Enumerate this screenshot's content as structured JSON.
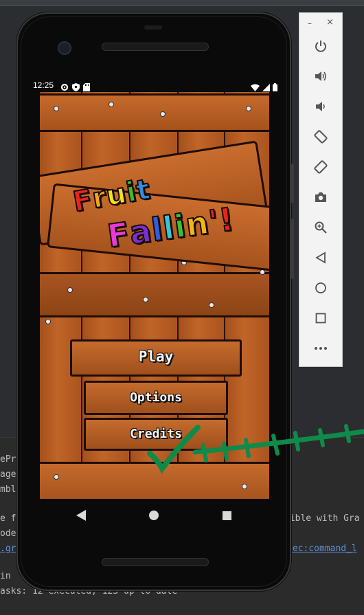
{
  "status_bar": {
    "time": "12:25",
    "left_icons": [
      "gear-icon",
      "shield-icon",
      "sd-card-icon"
    ],
    "right_icons": [
      "wifi-icon",
      "signal-icon",
      "battery-icon"
    ]
  },
  "game": {
    "title_line1": "Fruit",
    "title_line2": "Fallin'!",
    "title_line1_letters": [
      {
        "ch": "F",
        "color": "#e8241f"
      },
      {
        "ch": "r",
        "color": "#f2a51a"
      },
      {
        "ch": "u",
        "color": "#f2e11a"
      },
      {
        "ch": "i",
        "color": "#38c02f"
      },
      {
        "ch": "t",
        "color": "#2f8ee0"
      }
    ],
    "title_line2_letters": [
      {
        "ch": "F",
        "color": "#e63bd8"
      },
      {
        "ch": "a",
        "color": "#7a2fd6"
      },
      {
        "ch": "l",
        "color": "#2f5fe0"
      },
      {
        "ch": "l",
        "color": "#34c7d9"
      },
      {
        "ch": "i",
        "color": "#36c437"
      },
      {
        "ch": "n",
        "color": "#f2b51a"
      },
      {
        "ch": "'",
        "color": "#e8241f"
      },
      {
        "ch": "!",
        "color": "#e8241f"
      }
    ],
    "menu": {
      "play": "Play",
      "options": "Options",
      "credits": "Credits"
    }
  },
  "nav_bar": {
    "buttons": [
      "back-icon",
      "home-icon",
      "recents-icon"
    ]
  },
  "emulator_toolbar": {
    "minimize": "–",
    "close": "×",
    "buttons": [
      "power-icon",
      "volume-up-icon",
      "volume-down-icon",
      "rotate-left-icon",
      "rotate-right-icon",
      "camera-icon",
      "zoom-icon",
      "back-icon",
      "home-icon",
      "overview-icon",
      "more-icon"
    ]
  },
  "console": {
    "lines": [
      "ePr",
      "age",
      "mbl",
      "",
      "e f",
      "ode",
      ".gr",
      "",
      " in",
      "asks: 12 executed, 123 up-to-date"
    ],
    "right_fragment_1": "tible with Gra",
    "right_fragment_2": "sec:command_l"
  },
  "colors": {
    "wood": "#b35a22",
    "scribble_green": "#0f8a4a"
  }
}
